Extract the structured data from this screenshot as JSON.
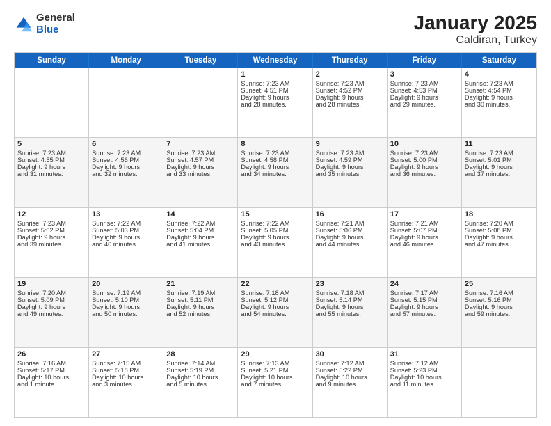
{
  "header": {
    "logo_general": "General",
    "logo_blue": "Blue",
    "title": "January 2025",
    "subtitle": "Caldiran, Turkey"
  },
  "weekdays": [
    "Sunday",
    "Monday",
    "Tuesday",
    "Wednesday",
    "Thursday",
    "Friday",
    "Saturday"
  ],
  "rows": [
    {
      "alt": false,
      "cells": [
        {
          "day": "",
          "lines": []
        },
        {
          "day": "",
          "lines": []
        },
        {
          "day": "",
          "lines": []
        },
        {
          "day": "1",
          "lines": [
            "Sunrise: 7:23 AM",
            "Sunset: 4:51 PM",
            "Daylight: 9 hours",
            "and 28 minutes."
          ]
        },
        {
          "day": "2",
          "lines": [
            "Sunrise: 7:23 AM",
            "Sunset: 4:52 PM",
            "Daylight: 9 hours",
            "and 28 minutes."
          ]
        },
        {
          "day": "3",
          "lines": [
            "Sunrise: 7:23 AM",
            "Sunset: 4:53 PM",
            "Daylight: 9 hours",
            "and 29 minutes."
          ]
        },
        {
          "day": "4",
          "lines": [
            "Sunrise: 7:23 AM",
            "Sunset: 4:54 PM",
            "Daylight: 9 hours",
            "and 30 minutes."
          ]
        }
      ]
    },
    {
      "alt": true,
      "cells": [
        {
          "day": "5",
          "lines": [
            "Sunrise: 7:23 AM",
            "Sunset: 4:55 PM",
            "Daylight: 9 hours",
            "and 31 minutes."
          ]
        },
        {
          "day": "6",
          "lines": [
            "Sunrise: 7:23 AM",
            "Sunset: 4:56 PM",
            "Daylight: 9 hours",
            "and 32 minutes."
          ]
        },
        {
          "day": "7",
          "lines": [
            "Sunrise: 7:23 AM",
            "Sunset: 4:57 PM",
            "Daylight: 9 hours",
            "and 33 minutes."
          ]
        },
        {
          "day": "8",
          "lines": [
            "Sunrise: 7:23 AM",
            "Sunset: 4:58 PM",
            "Daylight: 9 hours",
            "and 34 minutes."
          ]
        },
        {
          "day": "9",
          "lines": [
            "Sunrise: 7:23 AM",
            "Sunset: 4:59 PM",
            "Daylight: 9 hours",
            "and 35 minutes."
          ]
        },
        {
          "day": "10",
          "lines": [
            "Sunrise: 7:23 AM",
            "Sunset: 5:00 PM",
            "Daylight: 9 hours",
            "and 36 minutes."
          ]
        },
        {
          "day": "11",
          "lines": [
            "Sunrise: 7:23 AM",
            "Sunset: 5:01 PM",
            "Daylight: 9 hours",
            "and 37 minutes."
          ]
        }
      ]
    },
    {
      "alt": false,
      "cells": [
        {
          "day": "12",
          "lines": [
            "Sunrise: 7:23 AM",
            "Sunset: 5:02 PM",
            "Daylight: 9 hours",
            "and 39 minutes."
          ]
        },
        {
          "day": "13",
          "lines": [
            "Sunrise: 7:22 AM",
            "Sunset: 5:03 PM",
            "Daylight: 9 hours",
            "and 40 minutes."
          ]
        },
        {
          "day": "14",
          "lines": [
            "Sunrise: 7:22 AM",
            "Sunset: 5:04 PM",
            "Daylight: 9 hours",
            "and 41 minutes."
          ]
        },
        {
          "day": "15",
          "lines": [
            "Sunrise: 7:22 AM",
            "Sunset: 5:05 PM",
            "Daylight: 9 hours",
            "and 43 minutes."
          ]
        },
        {
          "day": "16",
          "lines": [
            "Sunrise: 7:21 AM",
            "Sunset: 5:06 PM",
            "Daylight: 9 hours",
            "and 44 minutes."
          ]
        },
        {
          "day": "17",
          "lines": [
            "Sunrise: 7:21 AM",
            "Sunset: 5:07 PM",
            "Daylight: 9 hours",
            "and 46 minutes."
          ]
        },
        {
          "day": "18",
          "lines": [
            "Sunrise: 7:20 AM",
            "Sunset: 5:08 PM",
            "Daylight: 9 hours",
            "and 47 minutes."
          ]
        }
      ]
    },
    {
      "alt": true,
      "cells": [
        {
          "day": "19",
          "lines": [
            "Sunrise: 7:20 AM",
            "Sunset: 5:09 PM",
            "Daylight: 9 hours",
            "and 49 minutes."
          ]
        },
        {
          "day": "20",
          "lines": [
            "Sunrise: 7:19 AM",
            "Sunset: 5:10 PM",
            "Daylight: 9 hours",
            "and 50 minutes."
          ]
        },
        {
          "day": "21",
          "lines": [
            "Sunrise: 7:19 AM",
            "Sunset: 5:11 PM",
            "Daylight: 9 hours",
            "and 52 minutes."
          ]
        },
        {
          "day": "22",
          "lines": [
            "Sunrise: 7:18 AM",
            "Sunset: 5:12 PM",
            "Daylight: 9 hours",
            "and 54 minutes."
          ]
        },
        {
          "day": "23",
          "lines": [
            "Sunrise: 7:18 AM",
            "Sunset: 5:14 PM",
            "Daylight: 9 hours",
            "and 55 minutes."
          ]
        },
        {
          "day": "24",
          "lines": [
            "Sunrise: 7:17 AM",
            "Sunset: 5:15 PM",
            "Daylight: 9 hours",
            "and 57 minutes."
          ]
        },
        {
          "day": "25",
          "lines": [
            "Sunrise: 7:16 AM",
            "Sunset: 5:16 PM",
            "Daylight: 9 hours",
            "and 59 minutes."
          ]
        }
      ]
    },
    {
      "alt": false,
      "cells": [
        {
          "day": "26",
          "lines": [
            "Sunrise: 7:16 AM",
            "Sunset: 5:17 PM",
            "Daylight: 10 hours",
            "and 1 minute."
          ]
        },
        {
          "day": "27",
          "lines": [
            "Sunrise: 7:15 AM",
            "Sunset: 5:18 PM",
            "Daylight: 10 hours",
            "and 3 minutes."
          ]
        },
        {
          "day": "28",
          "lines": [
            "Sunrise: 7:14 AM",
            "Sunset: 5:19 PM",
            "Daylight: 10 hours",
            "and 5 minutes."
          ]
        },
        {
          "day": "29",
          "lines": [
            "Sunrise: 7:13 AM",
            "Sunset: 5:21 PM",
            "Daylight: 10 hours",
            "and 7 minutes."
          ]
        },
        {
          "day": "30",
          "lines": [
            "Sunrise: 7:12 AM",
            "Sunset: 5:22 PM",
            "Daylight: 10 hours",
            "and 9 minutes."
          ]
        },
        {
          "day": "31",
          "lines": [
            "Sunrise: 7:12 AM",
            "Sunset: 5:23 PM",
            "Daylight: 10 hours",
            "and 11 minutes."
          ]
        },
        {
          "day": "",
          "lines": []
        }
      ]
    }
  ]
}
